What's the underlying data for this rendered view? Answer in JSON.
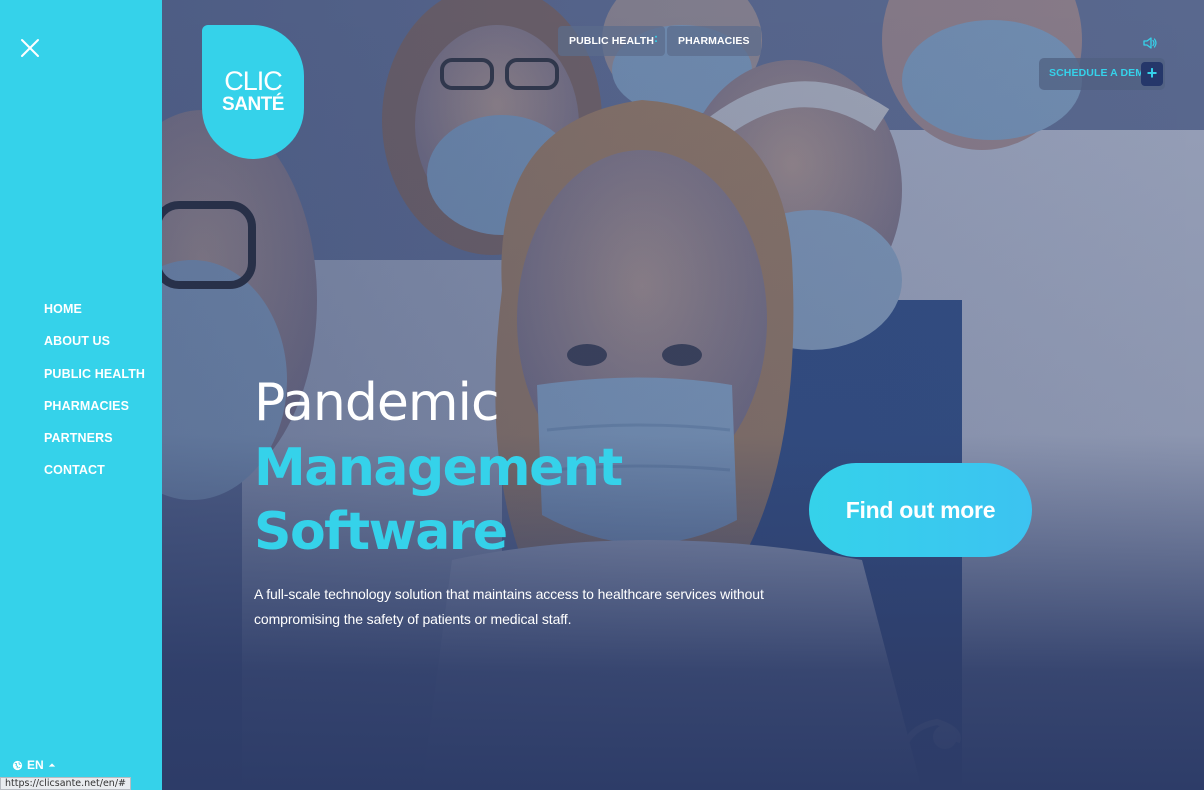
{
  "sidebar": {
    "close_icon": "close-icon",
    "nav": [
      {
        "label": "HOME"
      },
      {
        "label": "ABOUT US"
      },
      {
        "label": "PUBLIC HEALTH"
      },
      {
        "label": "PHARMACIES"
      },
      {
        "label": "PARTNERS"
      },
      {
        "label": "CONTACT"
      }
    ],
    "language": "EN",
    "globe_icon": "globe-icon",
    "caret_icon": "caret-up-icon"
  },
  "status_bar": {
    "url": "https://clicsante.net/en/#"
  },
  "header": {
    "logo": {
      "line1": "CLIC",
      "line2": "SANTÉ"
    },
    "tabs": [
      {
        "label": "PUBLIC HEALTH"
      },
      {
        "label": "PHARMACIES"
      }
    ],
    "tab_separator": ":",
    "sound_icon": "speaker-icon",
    "demo": {
      "label": "SCHEDULE A DEMO",
      "plus": "+"
    }
  },
  "hero": {
    "headline_line1": "Pandemic",
    "headline_line2": "Management",
    "headline_line3": "Software",
    "subheading": "A full-scale technology solution that maintains access to healthcare services without compromising the safety of patients or medical staff.",
    "cta_label": "Find out more"
  },
  "colors": {
    "accent": "#35d2ea",
    "sidebar_bg": "#35d2ea",
    "hero_overlay": "#2d3c68",
    "text_light": "#ffffff"
  }
}
